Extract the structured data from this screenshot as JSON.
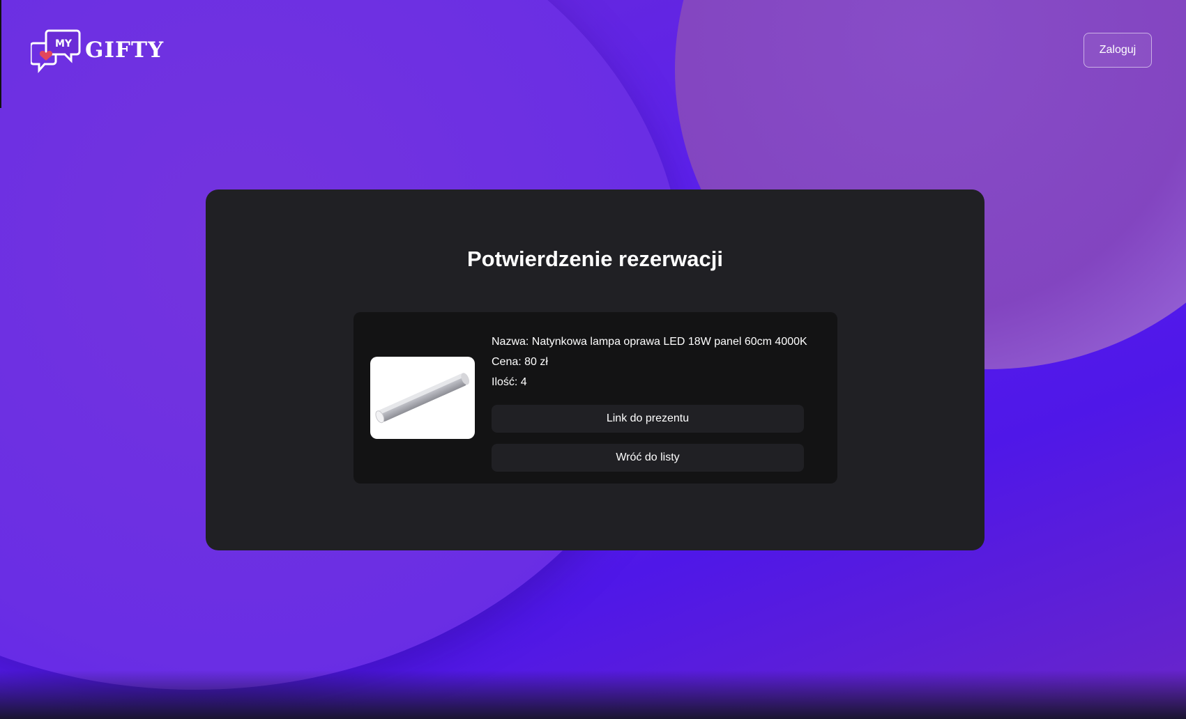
{
  "header": {
    "logo_text": "GIFTY",
    "logo_badge": "MY",
    "login_label": "Zaloguj"
  },
  "card": {
    "title": "Potwierdzenie rezerwacji",
    "item": {
      "name_line": "Nazwa: Natynkowa lampa oprawa LED 18W panel 60cm 4000K",
      "price_line": "Cena: 80 zł",
      "quantity_line": "Ilość: 4",
      "image_icon": "led-lamp-image"
    },
    "buttons": {
      "gift_link_label": "Link do prezentu",
      "back_label": "Wróć do listy"
    }
  },
  "colors": {
    "background_purple": "#5a1ff0",
    "card_bg": "#202024",
    "item_bg": "#131314",
    "accent_heart": "#e2465c"
  }
}
